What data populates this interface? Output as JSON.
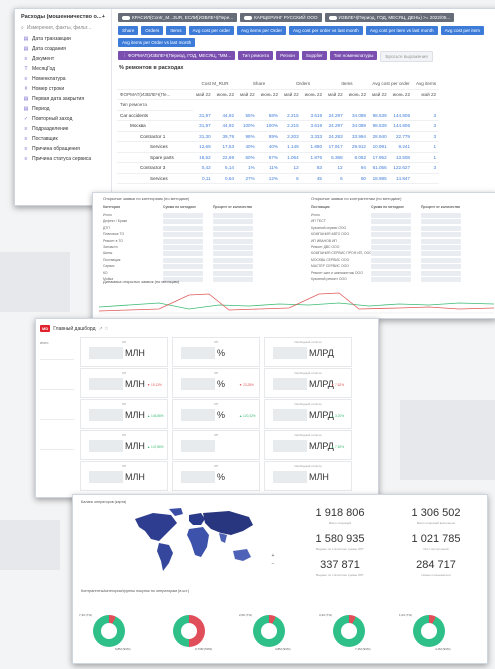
{
  "sidebar": {
    "title": "Расходы (мошенничество о...",
    "add_label": "+",
    "search_placeholder": "Измерения, факты, фильт...",
    "items": [
      {
        "icon": "▤",
        "label": "Дата транзакции"
      },
      {
        "icon": "▤",
        "label": "Дата создания"
      },
      {
        "icon": "≡",
        "label": "Документ"
      },
      {
        "icon": "T",
        "label": "МесяцГод"
      },
      {
        "icon": "≡",
        "label": "Номенклатура"
      },
      {
        "icon": "#",
        "label": "Номер строки"
      },
      {
        "icon": "▤",
        "label": "Первая дата закрытия"
      },
      {
        "icon": "▤",
        "label": "Период"
      },
      {
        "icon": "✓",
        "label": "Повторный заход"
      },
      {
        "icon": "≡",
        "label": "Подразделение"
      },
      {
        "icon": "≡",
        "label": "Поставщик"
      },
      {
        "icon": "≡",
        "label": "Причина обращения"
      },
      {
        "icon": "≡",
        "label": "Причина статуса сервиса"
      }
    ]
  },
  "filters": {
    "chip1": "КРАСИЛ(Contr_М...3UR, ЕСЛИ[ИЗВЛЕЧ(Пере...",
    "chip2": "КАРЩЕРИНГ РУССКИЙ ООО",
    "chip3": "ИЗВЛЕЧ(Период, ГОД, МЕСЯЦ, ДЕНЬ) >= 2022/05...",
    "measures": [
      "Share",
      "Orders",
      "Items",
      "Avg cost per order",
      "Avg items per Order",
      "Avg cost per order vs last month",
      "Avg cost per item vs last month",
      "Avg cost per item",
      "Avg items per Order vs last month"
    ],
    "row3": [
      "ФОРМАТ(ИЗВЛЕЧ(Период, ГОД, МЕСЯЦ, \"ММ...",
      "Тип ремонта",
      "Регион",
      "Supplier",
      "Тип номенклатуры"
    ],
    "drop_placeholder": "Бросьте выражение"
  },
  "pivot": {
    "title": "% ремонтов в расходах",
    "group_headers": [
      "Cost M_RUR",
      "Share",
      "Orders",
      "Items",
      "Avg cost per order",
      "Avg items"
    ],
    "format_header": "ФОРМАТ(ИЗВЛЕЧ(Пе...",
    "periods": [
      "май 22",
      "июнь 22",
      "май 22",
      "июнь 22",
      "май 22",
      "июнь 22",
      "май 22",
      "июнь 22",
      "май 22",
      "июнь 22",
      "май 22"
    ],
    "row_dim": "Тип ремонта",
    "rows": [
      {
        "label": "Car accidents",
        "indent": 0,
        "values": [
          "31,97",
          "44,92",
          "55%",
          "58%",
          "2.215",
          "3.619",
          "24.297",
          "34.089",
          "98.539",
          "144.806",
          "3"
        ]
      },
      {
        "label": "Москва",
        "indent": 1,
        "values": [
          "31,97",
          "44,92",
          "100%",
          "100%",
          "2.215",
          "3.619",
          "24.297",
          "34.089",
          "98.539",
          "144.806",
          "3"
        ]
      },
      {
        "label": "Contractor 1",
        "indent": 2,
        "values": [
          "31,30",
          "39,78",
          "98%",
          "89%",
          "2.203",
          "3.333",
          "24.283",
          "33.994",
          "28.940",
          "22.779",
          "3"
        ]
      },
      {
        "label": "Services",
        "indent": 3,
        "values": [
          "12,69",
          "17,53",
          "40%",
          "40%",
          "1.149",
          "1.890",
          "17.917",
          "29.912",
          "10.991",
          "9.241",
          "1"
        ]
      },
      {
        "label": "Spare parts",
        "indent": 3,
        "values": [
          "18,62",
          "22,69",
          "60%",
          "57%",
          "1.064",
          "1.876",
          "6.368",
          "8.082",
          "17.952",
          "13.508",
          "1"
        ]
      },
      {
        "label": "Contractor 3",
        "indent": 2,
        "values": [
          "0,42",
          "5,14",
          "1%",
          "11%",
          "12",
          "83",
          "12",
          "94",
          "61.056",
          "122.627",
          "3"
        ]
      },
      {
        "label": "Services",
        "indent": 3,
        "values": [
          "0,11",
          "0,64",
          "27%",
          "12%",
          "6",
          "45",
          "6",
          "50",
          "18.985",
          "14.847",
          ""
        ]
      }
    ]
  },
  "c2": {
    "title_left": "Открытые заявки по категориям (по методике)",
    "title_right": "Открытые заявки по контрагентам (по методике)",
    "left_cols": [
      "Категория",
      "Сумма по методике",
      "Процент от количества"
    ],
    "left_rows": [
      "Итого",
      "Дефект / Браки",
      "ДТП",
      "Плановое ТО",
      "Ремонт в ТО",
      "Запчасти",
      "Шины",
      "Поставщик",
      "Сервис",
      "КО",
      "Мойка"
    ],
    "right_cols": [
      "Поставщик",
      "Сумма по методике",
      "Процент от количества"
    ],
    "right_rows": [
      "Итого",
      "ИП ТЕСТ",
      "Кузовной сервис ООО",
      "КОМПАНИЯ АВТО ООО",
      "ИП ИВАНОВ ИП",
      "Ремонт ДВС ООО",
      "КОМПАНИЯ СЕРВИС ПРОФ ИП, ООО",
      "МОСКВА СЕРВИС ООО",
      "МАСТЕР СЕРВИС ООО",
      "Ремонт шин и шиномонтаж ООО",
      "Кузовной ремонт ООО"
    ],
    "bottom_title": "Динамика открытых заявок (по месяцам)"
  },
  "c3": {
    "logo": "MD",
    "title": "Главный дашборд",
    "title_icons": "↗ ☆",
    "left_label": "итого",
    "tiles": [
      {
        "cap": "ЗП",
        "unit": "МЛН",
        "pct": ""
      },
      {
        "cap": "ЗП",
        "unit": "%",
        "pct": ""
      },
      {
        "cap": "Свободный остаток",
        "unit": "МЛРД",
        "pct": ""
      },
      {
        "cap": "ЗП",
        "unit": "МЛН",
        "pct": "▼ 15,13%"
      },
      {
        "cap": "ЗП",
        "unit": "%",
        "pct": "▼ 23,28%"
      },
      {
        "cap": "Свободный остаток",
        "unit": "МЛРД",
        "pct": "▼ 7,82%"
      },
      {
        "cap": "ЗП",
        "unit": "МЛН",
        "pct": "▲ 146,86%"
      },
      {
        "cap": "ЗП",
        "unit": "%",
        "pct": "▲ 120,32%"
      },
      {
        "cap": "Свободный остаток",
        "unit": "МЛРД",
        "pct": "▲ 3,20%"
      },
      {
        "cap": "ЗП",
        "unit": "МЛН",
        "pct": "▲ 147,86%"
      },
      {
        "cap": "ЗП",
        "unit": "",
        "pct": ""
      },
      {
        "cap": "Свободный остаток",
        "unit": "МЛРД",
        "pct": "▲ 7,82%"
      },
      {
        "cap": "ЗП",
        "unit": "МЛН",
        "pct": ""
      },
      {
        "cap": "ЗП",
        "unit": "%",
        "pct": ""
      },
      {
        "cap": "Свободный остаток",
        "unit": "МЛН",
        "pct": ""
      }
    ]
  },
  "c4": {
    "map_title": "Баланс операторов (карта)",
    "zoom_in": "+",
    "zoom_out": "−",
    "kpis": [
      {
        "value": "1 918 806",
        "cap": "Всего операций"
      },
      {
        "value": "1 306 502",
        "cap": "Всего операций выполнено"
      },
      {
        "value": "1 580 935",
        "cap": "Выдано по статистике суммы ОРГ"
      },
      {
        "value": "1 021 785",
        "cap": "Рост поступлений"
      },
      {
        "value": "337 871",
        "cap": "Выдано по статистике суммы ОРГ"
      },
      {
        "value": "284 717",
        "cap": "Новые пользователи"
      }
    ],
    "donut_title": "Контрагенты/категории/группы покупок по операторам (в шт.)",
    "donuts": [
      {
        "top": "7,43 (7%)",
        "bottom": "6,8M (93%)"
      },
      {
        "top": "",
        "bottom": "0,73M (50%)"
      },
      {
        "top": "2,06 (7%)",
        "bottom": "4,8M (93%)"
      },
      {
        "top": "3,43 (7%)",
        "bottom": "7,1M (93%)"
      },
      {
        "top": "1,04 (7%)",
        "bottom": "4,1M (93%)"
      }
    ]
  }
}
